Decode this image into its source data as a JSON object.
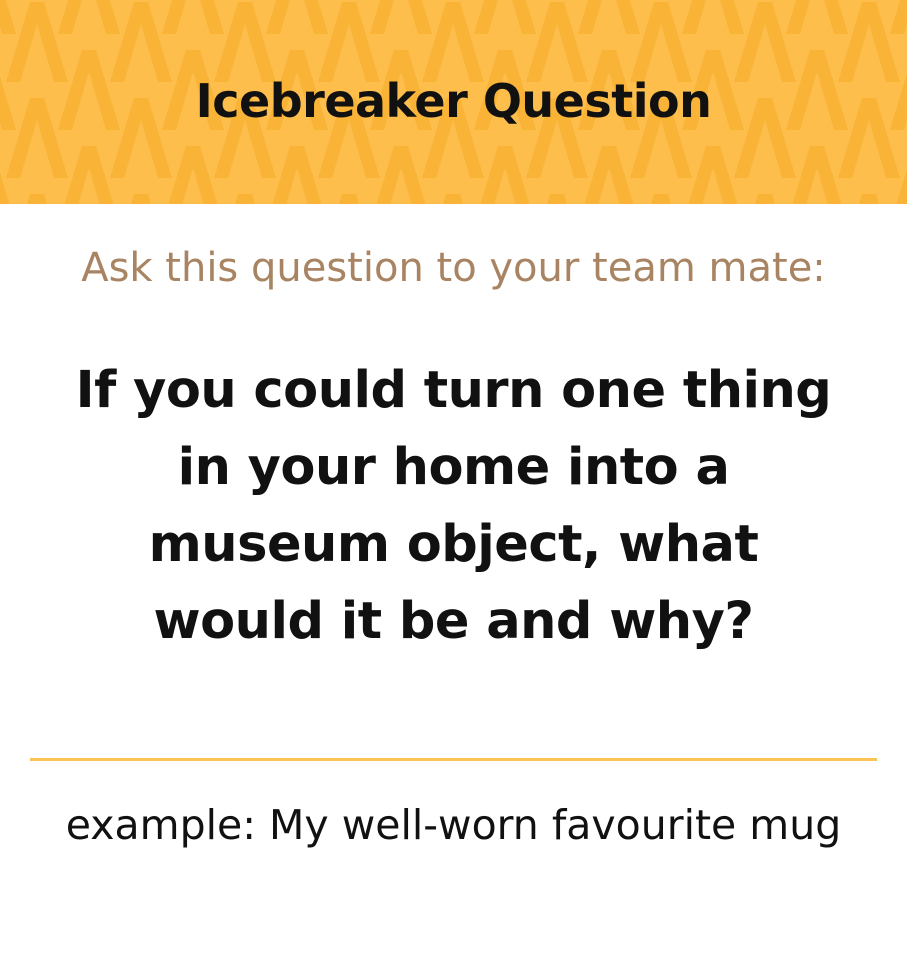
{
  "header": {
    "title": "Icebreaker Question",
    "background_color": "#FDBE4C",
    "pattern_color": "#F9B336"
  },
  "prompt": {
    "text": "Ask this question to your team mate:",
    "color": "#A98463"
  },
  "question": {
    "text": "If you could turn one thing in your home into a museum object, what would it be and why?"
  },
  "divider": {
    "color": "#F9C355"
  },
  "example": {
    "text": "example: My well-worn favourite mug"
  }
}
